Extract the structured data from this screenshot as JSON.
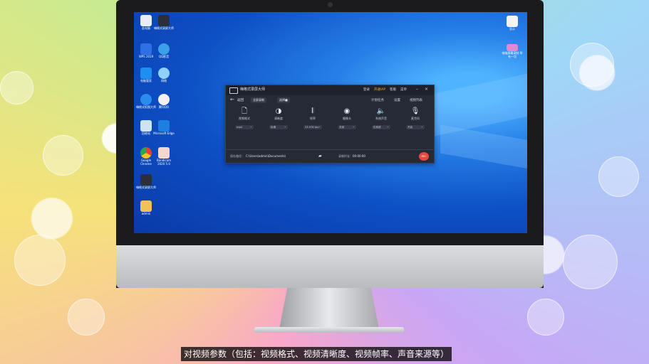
{
  "desktop": {
    "icons_left": [
      {
        "label": "此电脑"
      },
      {
        "label": "嗨格式录屏大师"
      },
      {
        "label": "WPS 2019"
      },
      {
        "label": "QQ影音"
      },
      {
        "label": "电脑管家"
      },
      {
        "label": "网络"
      },
      {
        "label": "嗨格式抠图大师"
      },
      {
        "label": "腾讯QQ"
      },
      {
        "label": "回收站"
      },
      {
        "label": "Microsoft Edge"
      },
      {
        "label": "Google Chrome"
      },
      {
        "label": "Bandicam 2020 5.0"
      },
      {
        "label": "嗨格式录屏大师"
      },
      {
        "label": "admin"
      }
    ],
    "icons_right": [
      {
        "label": "显示"
      },
      {
        "label": "电脑屏幕录制 所有一切 "
      }
    ]
  },
  "app": {
    "title": "嗨格式录屏大师",
    "links": {
      "login": "登录",
      "vip": "开通VIP",
      "feedback": "客服",
      "menu": "菜单"
    },
    "controls": {
      "minimize": "–",
      "close": "×"
    },
    "toolbar": {
      "back_label": "返回",
      "mode": "全屏录制",
      "area": "选择■",
      "timer": "计划任务",
      "settings": "设置",
      "video_list": "视频列表"
    },
    "options": [
      {
        "label": "视频格式",
        "value": "mp4",
        "icon": "file-icon"
      },
      {
        "label": "清晰度",
        "value": "标清",
        "icon": "clarity-icon"
      },
      {
        "label": "帧率",
        "value": "23.976 fps",
        "icon": "waveform-icon"
      },
      {
        "label": "摄像头",
        "value": "关闭",
        "icon": "camera-icon"
      },
      {
        "label": "系统声音",
        "value": "仅系统",
        "icon": "speaker-icon"
      },
      {
        "label": "麦克风",
        "value": "开启",
        "icon": "mic-icon"
      }
    ],
    "bottom": {
      "save_label": "保存路径：",
      "save_path": "C:\\Users\\admin\\Documents\\",
      "duration_label": "录制时长：",
      "duration": "00:00:00",
      "rec_label": "REC"
    }
  },
  "caption": "对视频参数（包括：视频格式、视频清晰度、视频帧率、声音来源等）"
}
